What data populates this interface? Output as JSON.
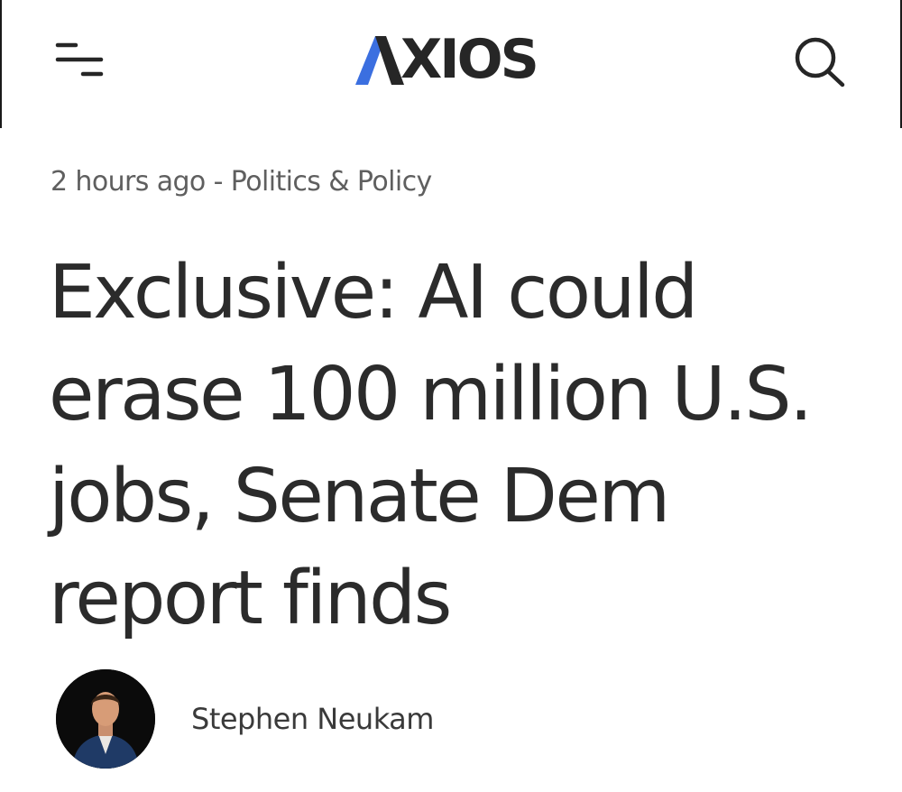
{
  "header": {
    "logo_text": "XIOS",
    "logo_accent_color": "#3b6fe0",
    "menu_icon": "menu-icon",
    "search_icon": "search-icon"
  },
  "article": {
    "time_ago": "2 hours ago",
    "separator": " - ",
    "section": "Politics & Policy",
    "headline_lines": [
      "Exclusive: AI could",
      "erase 100 million U.S.",
      "jobs, Senate Dem",
      "report finds"
    ],
    "author": "Stephen Neukam"
  }
}
